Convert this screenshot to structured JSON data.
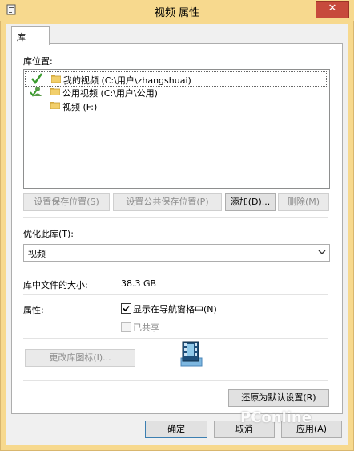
{
  "window": {
    "title": "视频 属性",
    "close_glyph": "✕"
  },
  "tabs": [
    {
      "label": "库"
    }
  ],
  "library_locations": {
    "label": "库位置:",
    "items": [
      {
        "text": "我的视频 (C:\\用户\\zhangshuai)",
        "mark": "save-location-check",
        "selected": true
      },
      {
        "text": "公用视频 (C:\\用户\\公用)",
        "mark": "public-save-location",
        "selected": false
      },
      {
        "text": "视频 (F:)",
        "mark": "",
        "selected": false
      }
    ]
  },
  "buttons": {
    "set_save_location": "设置保存位置(S)",
    "set_public_save_location": "设置公共保存位置(P)",
    "add": "添加(D)...",
    "remove": "删除(M)",
    "change_icon": "更改库图标(I)...",
    "restore_defaults": "还原为默认设置(R)",
    "ok": "确定",
    "cancel": "取消",
    "apply": "应用(A)"
  },
  "optimize": {
    "label": "优化此库(T):",
    "selected": "视频"
  },
  "size": {
    "label": "库中文件的大小:",
    "value": "38.3 GB"
  },
  "attributes": {
    "label": "属性:",
    "show_in_nav": {
      "label": "显示在导航窗格中(N)",
      "checked": true
    },
    "shared": {
      "label": "已共享",
      "checked": false,
      "disabled": true
    }
  },
  "watermark": "PConline",
  "colors": {
    "title_bar": "#f7d98e",
    "close_button": "#c74a3c",
    "check_green": "#3a9b2e"
  }
}
